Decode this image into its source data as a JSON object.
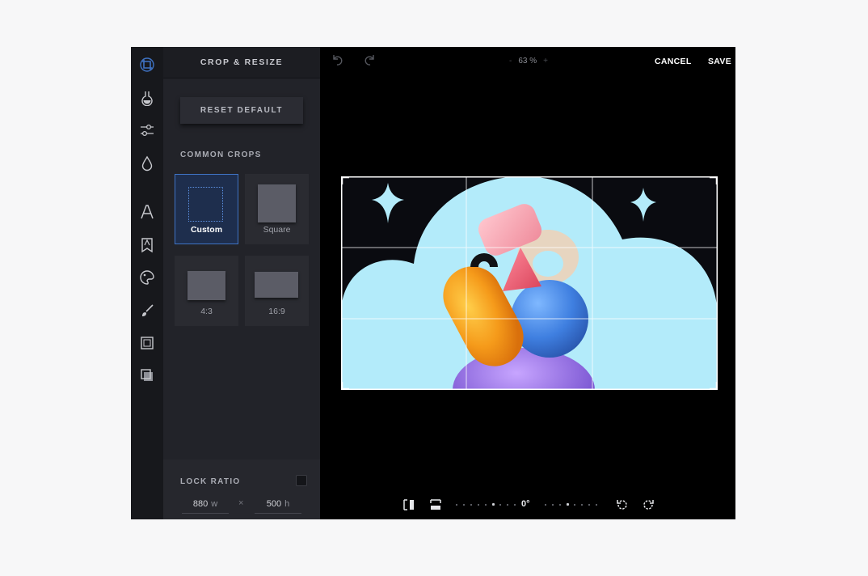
{
  "colors": {
    "accent": "#3f73c4",
    "panel": "#222329",
    "rail": "#17181c",
    "canvas": "#000000",
    "sky": "#b3ebfa"
  },
  "rail": [
    {
      "icon": "crop-icon",
      "active": true
    },
    {
      "icon": "filter-flask-icon"
    },
    {
      "icon": "adjust-sliders-icon"
    },
    {
      "icon": "drop-icon"
    },
    {
      "icon": "text-icon"
    },
    {
      "icon": "sticker-icon"
    },
    {
      "icon": "brush-palette-icon"
    },
    {
      "icon": "draw-brush-icon"
    },
    {
      "icon": "frame-icon"
    },
    {
      "icon": "overlay-icon"
    }
  ],
  "panel": {
    "title": "CROP & RESIZE",
    "reset_label": "RESET DEFAULT",
    "section_label": "COMMON CROPS",
    "crops": [
      {
        "label": "Custom",
        "selected": true
      },
      {
        "label": "Square"
      },
      {
        "label": "4:3"
      },
      {
        "label": "16:9"
      }
    ],
    "lock_label": "LOCK RATIO",
    "lock_checked": false,
    "width_value": "880",
    "width_unit": "w",
    "times": "×",
    "height_value": "500",
    "height_unit": "h"
  },
  "topbar": {
    "zoom_minus": "-",
    "zoom": "63 %",
    "zoom_plus": "+",
    "cancel": "CANCEL",
    "save": "SAVE",
    "undo_icon": "undo-icon",
    "redo_icon": "redo-icon"
  },
  "bottombar": {
    "angle": "0°",
    "icons": [
      "flip-horizontal-icon",
      "flip-vertical-icon",
      "rotate-left-icon",
      "rotate-right-icon"
    ]
  }
}
